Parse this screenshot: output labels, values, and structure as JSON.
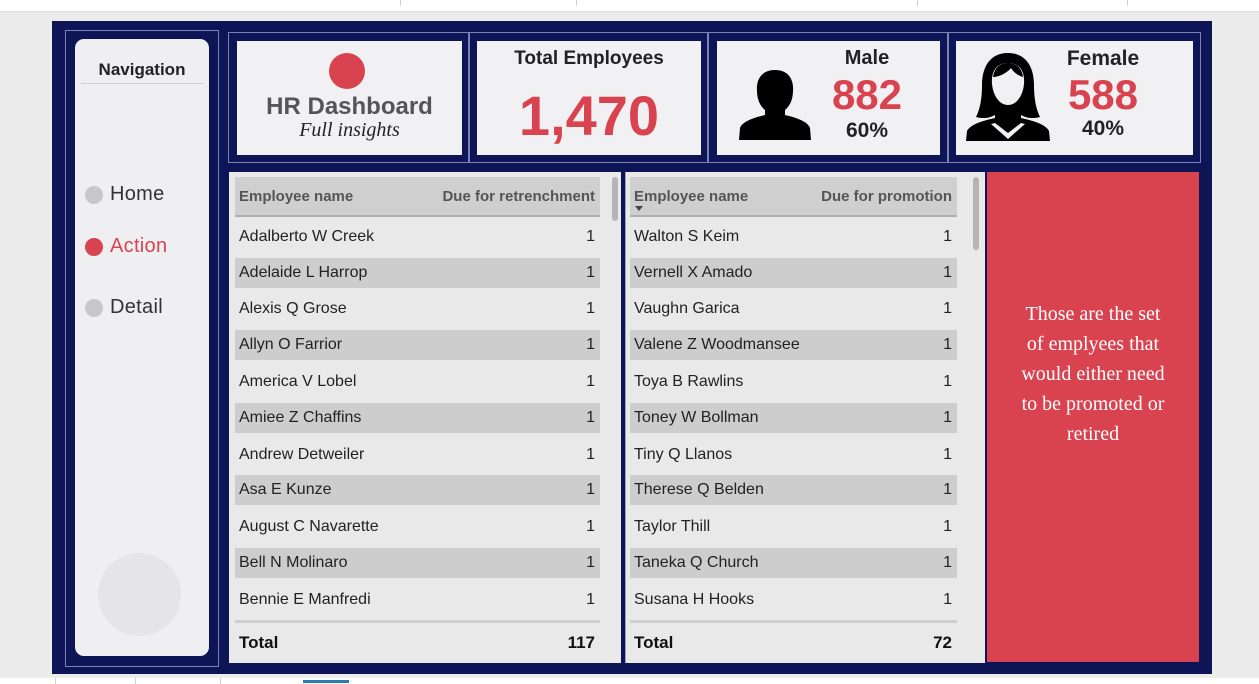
{
  "navigation": {
    "title": "Navigation",
    "items": [
      {
        "label": "Home",
        "active": false
      },
      {
        "label": "Action",
        "active": true
      },
      {
        "label": "Detail",
        "active": false
      }
    ]
  },
  "header": {
    "title": "HR Dashboard",
    "subtitle": "Full insights"
  },
  "kpis": {
    "total": {
      "label": "Total Employees",
      "value": "1,470"
    },
    "male": {
      "label": "Male",
      "value": "882",
      "percent": "60%"
    },
    "female": {
      "label": "Female",
      "value": "588",
      "percent": "40%"
    }
  },
  "retrenchment_table": {
    "col_name": "Employee name",
    "col_value": "Due for retrenchment",
    "rows": [
      {
        "name": "Adalberto W Creek",
        "value": "1"
      },
      {
        "name": "Adelaide L Harrop",
        "value": "1"
      },
      {
        "name": "Alexis Q Grose",
        "value": "1"
      },
      {
        "name": "Allyn O Farrior",
        "value": "1"
      },
      {
        "name": "America V Lobel",
        "value": "1"
      },
      {
        "name": "Amiee Z Chaffins",
        "value": "1"
      },
      {
        "name": "Andrew Detweiler",
        "value": "1"
      },
      {
        "name": "Asa E Kunze",
        "value": "1"
      },
      {
        "name": "August C Navarette",
        "value": "1"
      },
      {
        "name": "Bell N Molinaro",
        "value": "1"
      },
      {
        "name": "Bennie E Manfredi",
        "value": "1"
      }
    ],
    "total_label": "Total",
    "total_value": "117"
  },
  "promotion_table": {
    "col_name": "Employee name",
    "col_value": "Due for promotion",
    "rows": [
      {
        "name": "Walton S Keim",
        "value": "1"
      },
      {
        "name": "Vernell X Amado",
        "value": "1"
      },
      {
        "name": "Vaughn Garica",
        "value": "1"
      },
      {
        "name": "Valene Z Woodmansee",
        "value": "1"
      },
      {
        "name": "Toya B Rawlins",
        "value": "1"
      },
      {
        "name": "Toney W Bollman",
        "value": "1"
      },
      {
        "name": "Tiny Q Llanos",
        "value": "1"
      },
      {
        "name": "Therese Q Belden",
        "value": "1"
      },
      {
        "name": "Taylor Thill",
        "value": "1"
      },
      {
        "name": "Taneka Q Church",
        "value": "1"
      },
      {
        "name": "Susana H Hooks",
        "value": "1"
      }
    ],
    "total_label": "Total",
    "total_value": "72"
  },
  "note": {
    "lines": [
      "Those are the set",
      "of emplyees that",
      "would either need",
      "to be promoted or",
      "retired"
    ]
  },
  "colors": {
    "accent": "#d9434f",
    "frame": "#0d1557",
    "card": "#f1f1f3"
  },
  "icons": {
    "male": "male-silhouette-icon",
    "female": "female-silhouette-icon"
  }
}
